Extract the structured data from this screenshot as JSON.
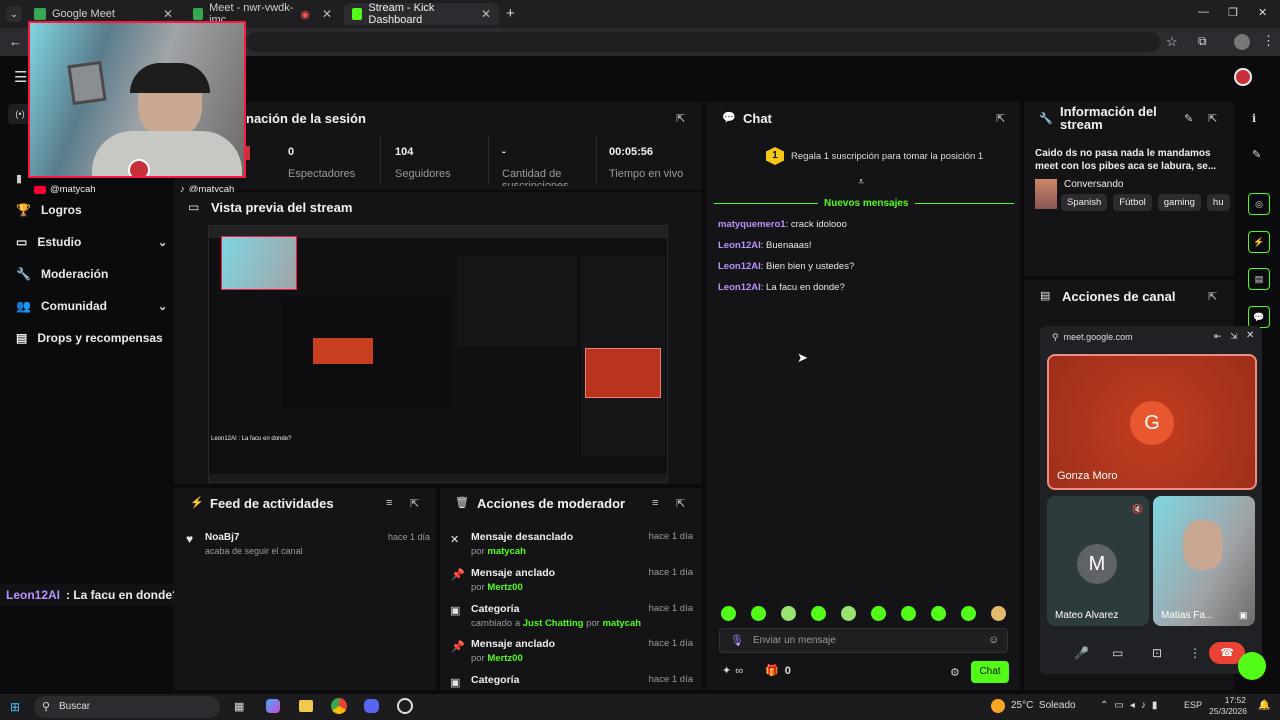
{
  "browser": {
    "tabs": [
      {
        "title": "Google Meet",
        "color": "#34a853"
      },
      {
        "title": "Meet - nwr-vwdk-jmc",
        "color": "#34a853"
      },
      {
        "title": "Stream - Kick Dashboard",
        "color": "#53fc18"
      }
    ]
  },
  "webcam": {
    "handle": "@matycah"
  },
  "tiktok_handle": "@matycah",
  "sidebar": {
    "items": [
      {
        "label": "Logros"
      },
      {
        "label": "Estudio"
      },
      {
        "label": "Moderación"
      },
      {
        "label": "Comunidad"
      },
      {
        "label": "Drops y recompensas"
      }
    ]
  },
  "session": {
    "title": "nación de la sesión",
    "stats": [
      {
        "value": "0",
        "label": "Espectadores"
      },
      {
        "value": "104",
        "label": "Seguidores"
      },
      {
        "value": "-",
        "label": "Cantidad de suscripciones"
      },
      {
        "value": "00:05:56",
        "label": "Tiempo en vivo"
      }
    ]
  },
  "preview": {
    "title": "Vista previa del stream",
    "overlay_msg": "Leon12AI : La facu en donde?"
  },
  "overlay_chat": {
    "user": "Leon12AI",
    "text": " : La facu en donde?"
  },
  "feed": {
    "title": "Feed de actividades",
    "items": [
      {
        "user": "NoaBj7",
        "text": "acaba de seguir el canal",
        "time": "hace 1 día"
      }
    ]
  },
  "modactions": {
    "title": "Acciones de moderador",
    "items": [
      {
        "title": "Mensaje desanclado",
        "pre": "por ",
        "who": "matycah",
        "time": "hace 1 día"
      },
      {
        "title": "Mensaje anclado",
        "pre": "por ",
        "who": "Mertz00",
        "time": "hace 1 día"
      },
      {
        "title": "Categoría",
        "pre": "cambiado a ",
        "who": "Just Chatting",
        "mid": " por ",
        "who2": "matycah",
        "time": "hace 1 día"
      },
      {
        "title": "Mensaje anclado",
        "pre": "por ",
        "who": "Mertz00",
        "time": "hace 1 día"
      },
      {
        "title": "Categoría",
        "time": "hace 1 día"
      }
    ]
  },
  "chat": {
    "title": "Chat",
    "gift_rank": "1",
    "gift_text": "Regala 1 suscripción para tomar la posición 1",
    "new_messages": "Nuevos mensajes",
    "messages": [
      {
        "user": "matyquemero1",
        "text": ": crack idolooo"
      },
      {
        "user": "Leon12AI",
        "text": ": Buenaaas!"
      },
      {
        "user": "Leon12AI",
        "text": ": Bien bien y ustedes?"
      },
      {
        "user": "Leon12AI",
        "text": ": La facu en donde?"
      }
    ],
    "placeholder": "Enviar un mensaje",
    "infinity": "∞",
    "points": "0",
    "send_label": "Chat"
  },
  "stream_info": {
    "title": "Información del stream",
    "description": "Caido ds no pasa nada le mandamos meet con los pibes aca se labura, se...",
    "category": "Conversando",
    "tags": [
      "Spanish",
      "Fútbol",
      "gaming",
      "hu"
    ]
  },
  "channel_actions": {
    "title": "Acciones de canal"
  },
  "meet": {
    "domain": "meet.google.com",
    "participants": [
      {
        "name": "Gonza Moro",
        "initial": "G"
      },
      {
        "name": "Mateo Alvarez",
        "initial": "M"
      },
      {
        "name": "Matias Fa..."
      }
    ]
  },
  "taskbar": {
    "search": "Buscar",
    "weather": "25°C  Soleado",
    "lang": "ESP",
    "time": "17:52",
    "date": "25/3/2026"
  }
}
